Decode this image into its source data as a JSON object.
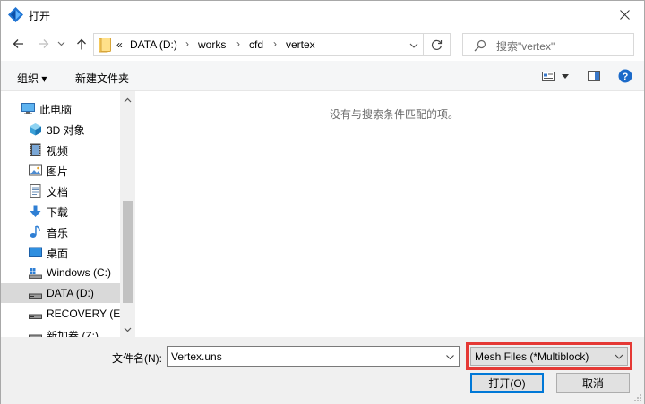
{
  "window": {
    "title": "打开"
  },
  "address": {
    "overflow": "«",
    "crumbs": [
      "DATA (D:)",
      "works",
      "cfd",
      "vertex"
    ],
    "separator": "›"
  },
  "search": {
    "placeholder": "搜索\"vertex\""
  },
  "toolbar": {
    "organize_label": "组织 ▾",
    "new_folder_label": "新建文件夹"
  },
  "sidebar": {
    "items": [
      {
        "label": "此电脑",
        "icon": "computer-icon"
      },
      {
        "label": "3D 对象",
        "icon": "3d-objects-icon"
      },
      {
        "label": "视频",
        "icon": "video-icon"
      },
      {
        "label": "图片",
        "icon": "pictures-icon"
      },
      {
        "label": "文档",
        "icon": "documents-icon"
      },
      {
        "label": "下载",
        "icon": "download-icon"
      },
      {
        "label": "音乐",
        "icon": "music-icon"
      },
      {
        "label": "桌面",
        "icon": "desktop-icon"
      },
      {
        "label": "Windows (C:)",
        "icon": "windows-drive-icon"
      },
      {
        "label": "DATA (D:)",
        "icon": "drive-icon",
        "selected": true
      },
      {
        "label": "RECOVERY (E:)",
        "icon": "drive-icon"
      },
      {
        "label": "新加卷 (Z:)",
        "icon": "drive-icon"
      }
    ]
  },
  "content": {
    "empty_message": "没有与搜索条件匹配的项。"
  },
  "bottom": {
    "filename_label": "文件名(N):",
    "filename_value": "Vertex.uns",
    "filter_value": "Mesh Files (*Multiblock)",
    "open_label": "打开(O)",
    "cancel_label": "取消"
  },
  "colors": {
    "accent": "#0078d7",
    "highlight_border": "#e53935",
    "selected_bg": "#d9d9d9"
  }
}
